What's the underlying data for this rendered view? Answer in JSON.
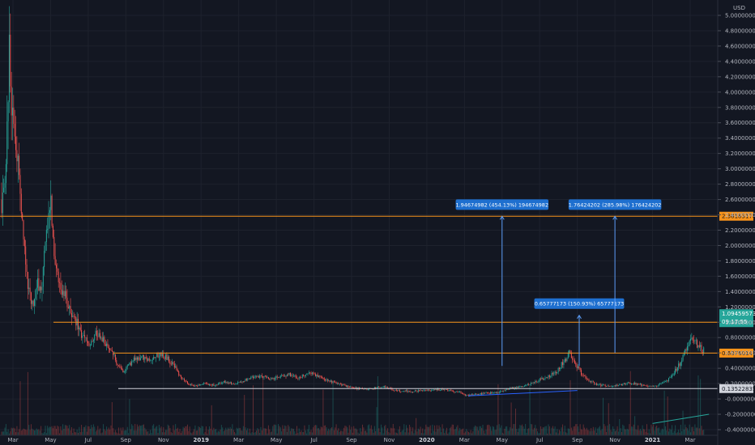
{
  "chart_data": {
    "type": "candlestick",
    "currency": "USD",
    "ylim": [
      -0.4,
      5.1
    ],
    "y_ticks": [
      "5.00000000",
      "4.80000000",
      "4.60000000",
      "4.40000000",
      "4.20000000",
      "4.00000000",
      "3.80000000",
      "3.60000000",
      "3.40000000",
      "3.20000000",
      "3.00000000",
      "2.80000000",
      "2.60000000",
      "2.40000000",
      "2.20000000",
      "2.00000000",
      "1.80000000",
      "1.60000000",
      "1.40000000",
      "1.20000000",
      "1.00000000",
      "0.80000000",
      "0.60000000",
      "0.40000000",
      "0.20000000",
      "-0.00000000",
      "-0.20000000",
      "-0.40000000"
    ],
    "y_tick_values": [
      5.0,
      4.8,
      4.6,
      4.4,
      4.2,
      4.0,
      3.8,
      3.6,
      3.4,
      3.2,
      3.0,
      2.8,
      2.6,
      2.4,
      2.2,
      2.0,
      1.8,
      1.6,
      1.4,
      1.2,
      1.0,
      0.8,
      0.6,
      0.4,
      0.2,
      0.0,
      -0.2,
      -0.4
    ],
    "x_ticks": [
      {
        "label": "Mar",
        "month": 0,
        "bold": false
      },
      {
        "label": "May",
        "month": 2,
        "bold": false
      },
      {
        "label": "Jul",
        "month": 4,
        "bold": false
      },
      {
        "label": "Sep",
        "month": 6,
        "bold": false
      },
      {
        "label": "Nov",
        "month": 8,
        "bold": false
      },
      {
        "label": "2019",
        "month": 10,
        "bold": true
      },
      {
        "label": "Mar",
        "month": 12,
        "bold": false
      },
      {
        "label": "May",
        "month": 14,
        "bold": false
      },
      {
        "label": "Jul",
        "month": 16,
        "bold": false
      },
      {
        "label": "Sep",
        "month": 18,
        "bold": false
      },
      {
        "label": "Nov",
        "month": 20,
        "bold": false
      },
      {
        "label": "2020",
        "month": 22,
        "bold": true
      },
      {
        "label": "Mar",
        "month": 24,
        "bold": false
      },
      {
        "label": "May",
        "month": 26,
        "bold": false
      },
      {
        "label": "Jul",
        "month": 28,
        "bold": false
      },
      {
        "label": "Sep",
        "month": 30,
        "bold": false
      },
      {
        "label": "Nov",
        "month": 32,
        "bold": false
      },
      {
        "label": "2021",
        "month": 34,
        "bold": true
      },
      {
        "label": "Mar",
        "month": 36,
        "bold": false
      }
    ],
    "xlim_months": [
      -0.5,
      37.5
    ],
    "price_path": [
      [
        -0.5,
        2.6
      ],
      [
        -0.35,
        3.3
      ],
      [
        -0.2,
        4.55
      ],
      [
        -0.05,
        3.7
      ],
      [
        0.1,
        3.4
      ],
      [
        0.3,
        2.9
      ],
      [
        0.5,
        2.2
      ],
      [
        0.7,
        1.7
      ],
      [
        0.9,
        1.3
      ],
      [
        1.1,
        1.25
      ],
      [
        1.3,
        1.5
      ],
      [
        1.5,
        1.4
      ],
      [
        1.7,
        1.9
      ],
      [
        1.85,
        2.3
      ],
      [
        2.0,
        2.55
      ],
      [
        2.15,
        2.1
      ],
      [
        2.3,
        1.6
      ],
      [
        2.6,
        1.45
      ],
      [
        2.9,
        1.25
      ],
      [
        3.2,
        1.1
      ],
      [
        3.5,
        0.92
      ],
      [
        3.8,
        0.78
      ],
      [
        4.1,
        0.72
      ],
      [
        4.4,
        0.85
      ],
      [
        4.7,
        0.82
      ],
      [
        5.0,
        0.7
      ],
      [
        5.3,
        0.6
      ],
      [
        5.6,
        0.42
      ],
      [
        5.9,
        0.36
      ],
      [
        6.2,
        0.45
      ],
      [
        6.5,
        0.52
      ],
      [
        6.9,
        0.55
      ],
      [
        7.3,
        0.5
      ],
      [
        7.7,
        0.58
      ],
      [
        8.1,
        0.55
      ],
      [
        8.5,
        0.45
      ],
      [
        8.9,
        0.3
      ],
      [
        9.3,
        0.2
      ],
      [
        9.7,
        0.17
      ],
      [
        10.2,
        0.2
      ],
      [
        10.7,
        0.18
      ],
      [
        11.2,
        0.22
      ],
      [
        11.7,
        0.2
      ],
      [
        12.2,
        0.23
      ],
      [
        12.7,
        0.28
      ],
      [
        13.2,
        0.3
      ],
      [
        13.7,
        0.26
      ],
      [
        14.2,
        0.3
      ],
      [
        14.7,
        0.32
      ],
      [
        15.2,
        0.28
      ],
      [
        15.7,
        0.34
      ],
      [
        16.2,
        0.3
      ],
      [
        16.7,
        0.24
      ],
      [
        17.2,
        0.2
      ],
      [
        17.7,
        0.17
      ],
      [
        18.2,
        0.14
      ],
      [
        18.7,
        0.13
      ],
      [
        19.2,
        0.14
      ],
      [
        19.7,
        0.16
      ],
      [
        20.2,
        0.12
      ],
      [
        20.7,
        0.1
      ],
      [
        21.2,
        0.1
      ],
      [
        21.7,
        0.11
      ],
      [
        22.2,
        0.12
      ],
      [
        22.7,
        0.12
      ],
      [
        23.2,
        0.11
      ],
      [
        23.7,
        0.09
      ],
      [
        24.2,
        0.04
      ],
      [
        24.6,
        0.06
      ],
      [
        25.0,
        0.07
      ],
      [
        25.5,
        0.08
      ],
      [
        26.0,
        0.1
      ],
      [
        26.5,
        0.14
      ],
      [
        27.0,
        0.16
      ],
      [
        27.5,
        0.2
      ],
      [
        28.0,
        0.25
      ],
      [
        28.5,
        0.3
      ],
      [
        28.9,
        0.36
      ],
      [
        29.3,
        0.5
      ],
      [
        29.6,
        0.6
      ],
      [
        29.9,
        0.45
      ],
      [
        30.3,
        0.3
      ],
      [
        30.7,
        0.22
      ],
      [
        31.2,
        0.18
      ],
      [
        31.7,
        0.16
      ],
      [
        32.2,
        0.18
      ],
      [
        32.7,
        0.21
      ],
      [
        33.2,
        0.2
      ],
      [
        33.7,
        0.16
      ],
      [
        34.2,
        0.17
      ],
      [
        34.7,
        0.22
      ],
      [
        35.1,
        0.33
      ],
      [
        35.5,
        0.48
      ],
      [
        35.8,
        0.65
      ],
      [
        36.1,
        0.78
      ],
      [
        36.4,
        0.7
      ],
      [
        36.7,
        0.62
      ],
      [
        37.0,
        0.85
      ],
      [
        37.2,
        1.1
      ]
    ],
    "horizontal_levels": [
      {
        "value": 2.381831,
        "label": "2.38183178",
        "color": "#f7931a"
      },
      {
        "value": 1.0,
        "label": "",
        "color": "#f7931a"
      },
      {
        "value": 0.597601,
        "label": "0.60760147",
        "color": "#f7931a"
      },
      {
        "value": 0.135228,
        "label": "0.13522835",
        "color": "#d1d4dc"
      }
    ],
    "current_price": {
      "value": 1.095095,
      "label": "1.09459573",
      "countdown": "09:17:55",
      "color": "#26a69a"
    },
    "measurements": [
      {
        "text": "1.94674982 (454.13%) 194674982",
        "month": 26.0,
        "from": 0.43,
        "to": 2.38
      },
      {
        "text": "0.65777173 (150.93%) 65777173",
        "month": 30.1,
        "from": 0.43,
        "to": 1.09
      },
      {
        "text": "1.76424202 (285.98%) 176424202",
        "month": 32.0,
        "from": 0.6,
        "to": 2.38
      }
    ],
    "trendlines": [
      {
        "from": [
          24.2,
          0.04
        ],
        "to": [
          30.0,
          0.11
        ],
        "color": "#2962ff"
      },
      {
        "from": [
          34.0,
          -0.32
        ],
        "to": [
          37.0,
          -0.2
        ],
        "color": "#26a69a"
      }
    ],
    "colors": {
      "up": "#26a69a",
      "down": "#ef5350",
      "grid": "#1e222d",
      "background": "#131722"
    }
  }
}
